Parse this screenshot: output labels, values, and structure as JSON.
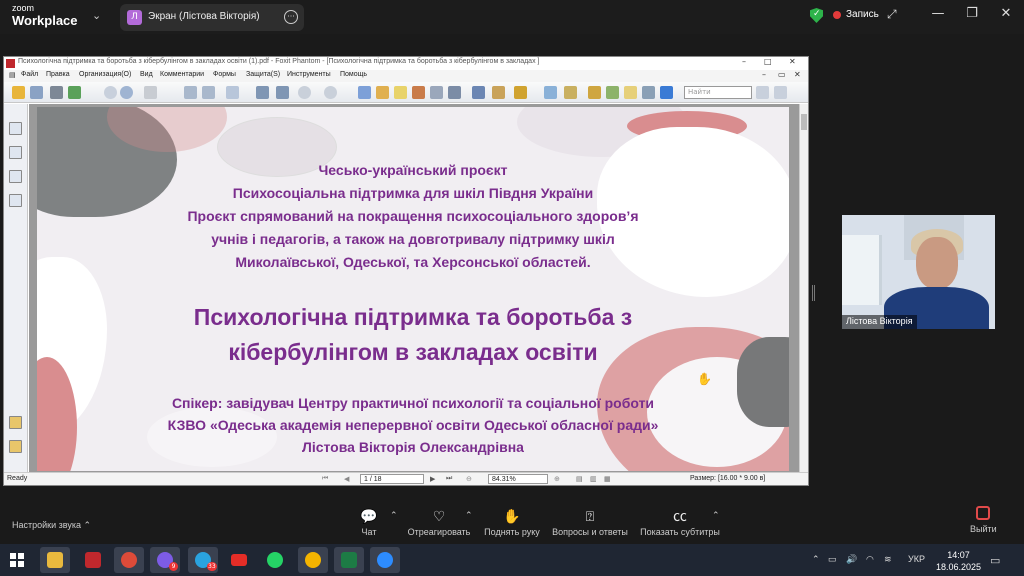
{
  "zoom": {
    "logo_line1": "zoom",
    "logo_line2": "Workplace",
    "tab_avatar": "Л",
    "tab_title": "Экран (Лістова Вікторія)",
    "record_label": "Запись",
    "window_controls": [
      "—",
      "❐",
      "✕"
    ]
  },
  "foxit": {
    "title": "Психологічна підтримка та боротьба з кібербулінгом в закладах освіти (1).pdf - Foxit Phantom - [Психологічна підтримка та боротьба з кібербулінгом в закладах ]",
    "menu": [
      "Файл",
      "Правка",
      "Организация(O)",
      "Вид",
      "Комментарии",
      "Формы",
      "Защита(S)",
      "Инструменты",
      "Помощь"
    ],
    "search_placeholder": "Найти",
    "status": {
      "ready": "Ready",
      "page": "1 / 18",
      "zoom": "84.31%",
      "size": "Размер: [16.00 * 9.00 в]"
    }
  },
  "slide": {
    "project_lines": [
      "Чесько-український проєкт",
      "Психосоціальна підтримка для шкіл Півдня України",
      "Проєкт спрямований на покращення психосоціального здоров’я",
      "учнів і педагогів, а також на довготривалу підтримку шкіл",
      "Миколаївської, Одеської, та Херсонської областей."
    ],
    "title_lines": [
      "Психологічна підтримка та боротьба з",
      "кібербулінгом в закладах освіти"
    ],
    "speaker_lines": [
      "Спікер: завідувач Центру практичної психології та соціальної роботи",
      "КЗВО «Одеська академія неперервної освіти Одеської обласної ради»",
      "Лістова Вікторія Олександрівна"
    ],
    "colors": {
      "text": "#7a2d8d",
      "background": "#f1eef2",
      "accent_pink": "#d98d8f",
      "accent_gray": "#777879"
    }
  },
  "participant": {
    "name": "Лістова Вікторія"
  },
  "controls": {
    "sound_settings": "Настройки звука",
    "chat": "Чат",
    "react": "Отреагировать",
    "raise_hand": "Поднять руку",
    "qa": "Вопросы и ответы",
    "captions": "Показать субтитры",
    "leave": "Выйти"
  },
  "taskbar": {
    "badges": {
      "viber": "9",
      "telegram": "33"
    },
    "language": "УКР",
    "time": "14:07",
    "date": "18.06.2025"
  }
}
